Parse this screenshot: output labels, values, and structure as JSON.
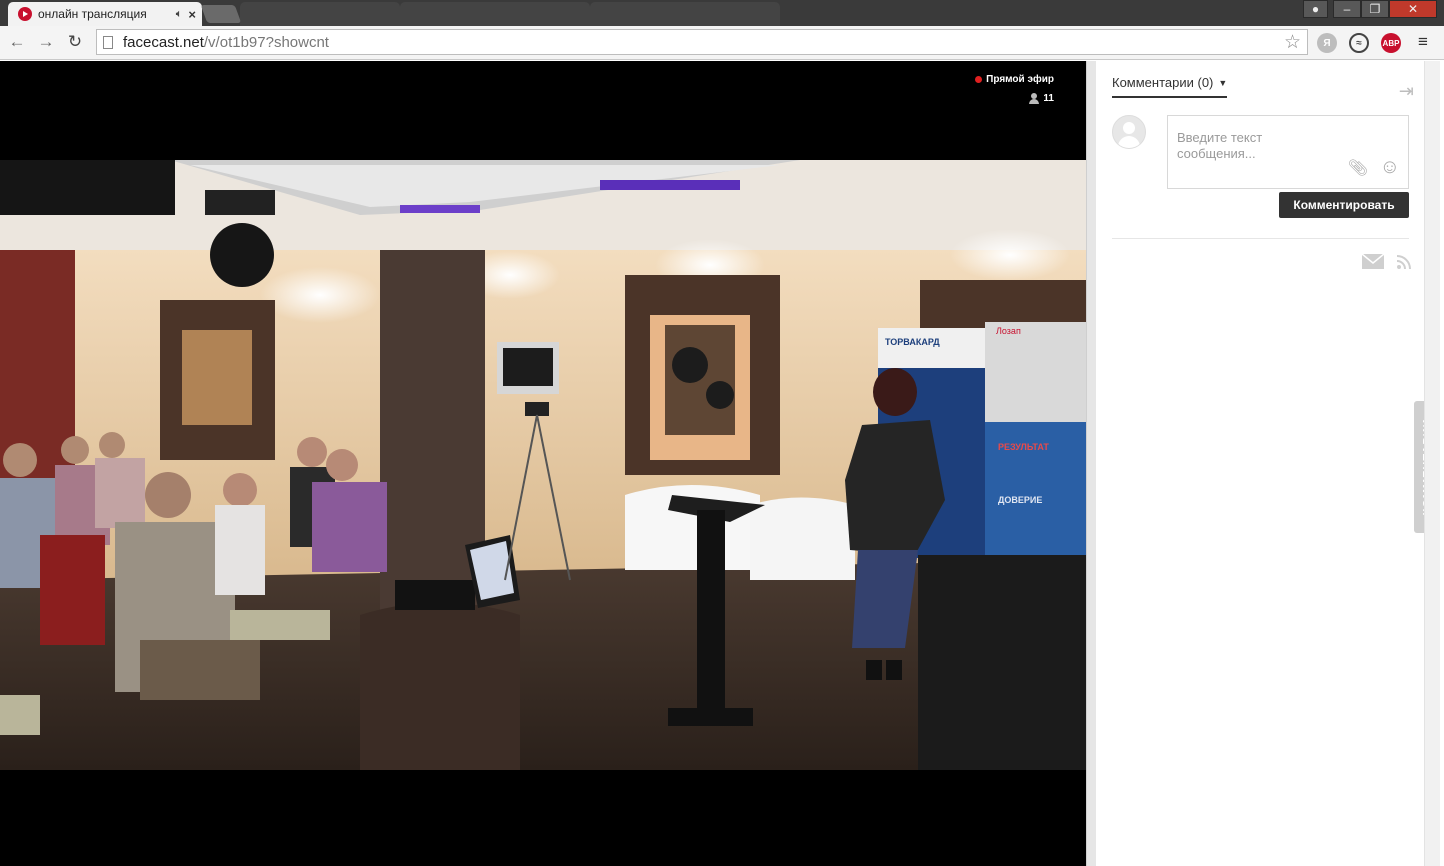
{
  "browser": {
    "tab_title": "онлайн трансляция",
    "url_host": "facecast.net",
    "url_path": "/v/ot1b97?showcnt",
    "ext_abp": "ABP",
    "ext_yandex": "Я"
  },
  "player": {
    "live_label": "Прямой эфир",
    "viewer_count": "11",
    "colors": {
      "live_dot": "#e02020"
    }
  },
  "stage": {
    "banner_brand": "ТОРВАКАРД",
    "banner_brand2": "Лозап",
    "banner_result": "РЕЗУЛЬТАТ",
    "banner_trust": "ДОВЕРИЕ"
  },
  "comments": {
    "header": "Комментарии (0)",
    "placeholder": "Введите текст сообщения...",
    "submit_label": "Комментировать",
    "side_tab_label": "КОММЕНТАРИИ"
  }
}
